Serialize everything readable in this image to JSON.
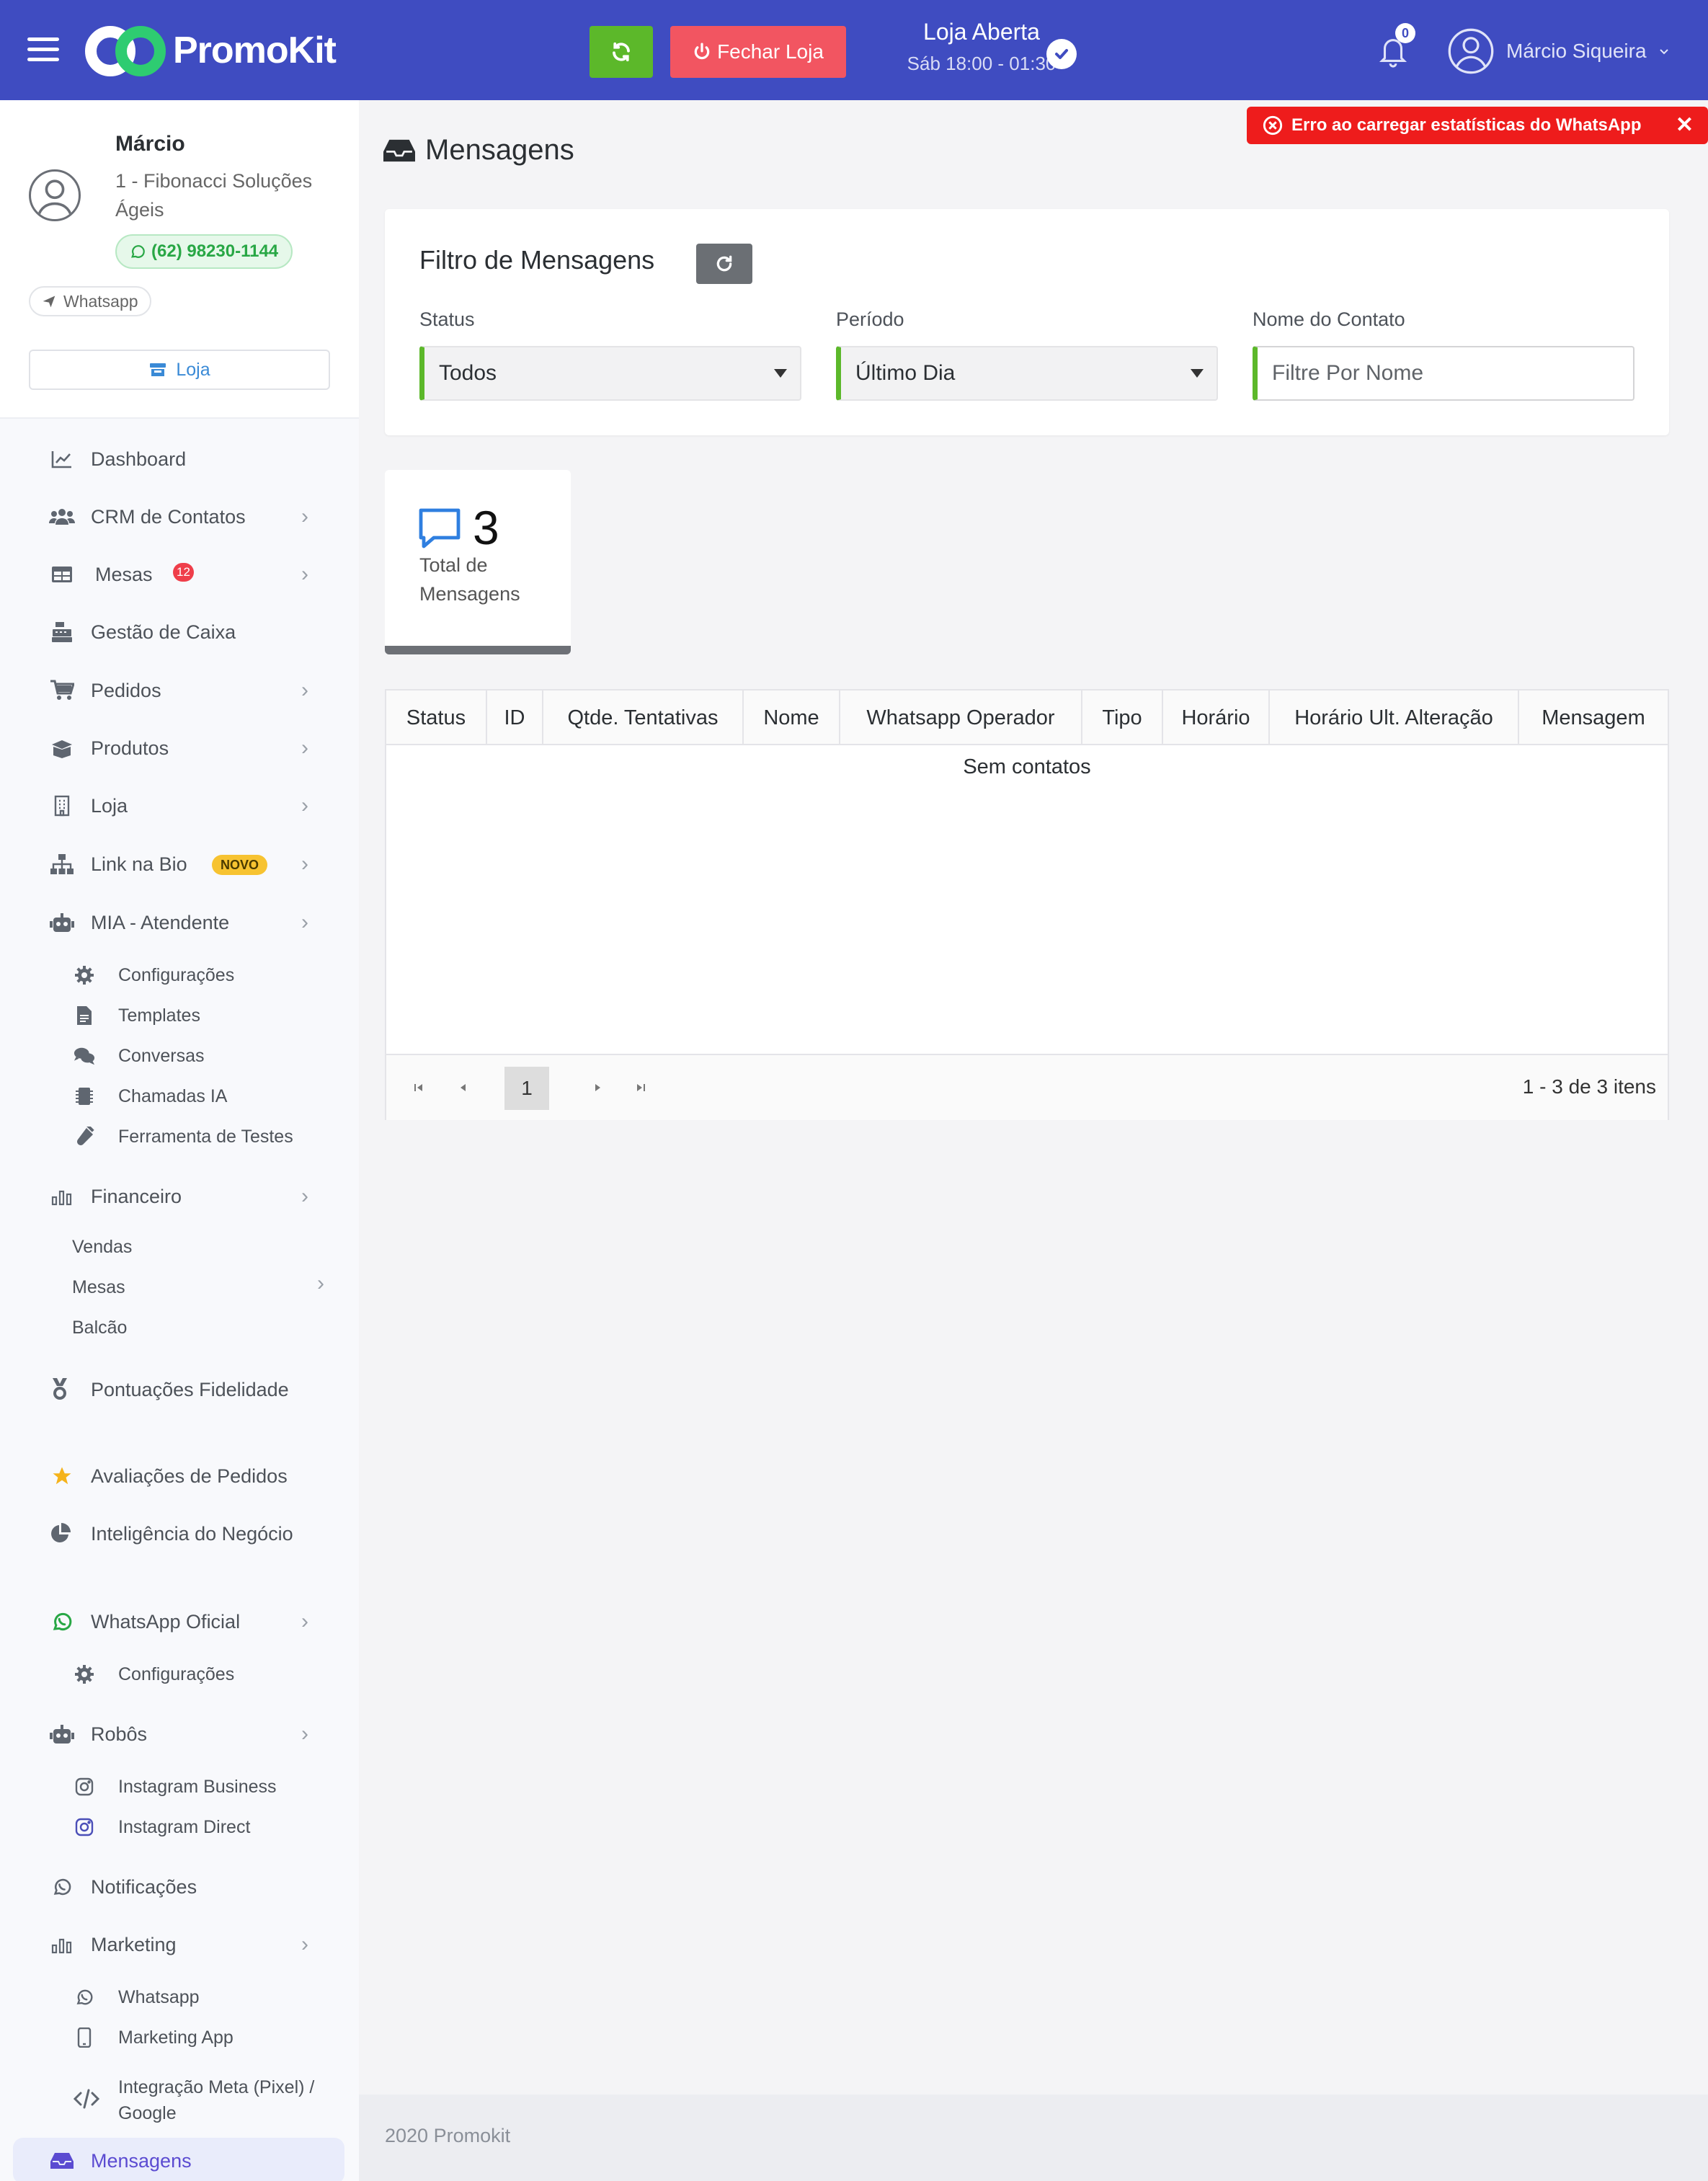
{
  "app": {
    "brand": "PromoKit",
    "brand_color": "#3f4cc1"
  },
  "header": {
    "close_store_label": "Fechar Loja",
    "store_status": "Loja Aberta",
    "store_hours": "Sáb 18:00 - 01:30",
    "notifications_count": "0",
    "user_name": "Márcio Siqueira"
  },
  "error_toast": {
    "message": "Erro ao carregar estatísticas do WhatsApp"
  },
  "profile": {
    "name": "Márcio",
    "company": "1 - Fibonacci Soluções Ágeis",
    "phone": "(62) 98230-1144",
    "channel": "Whatsapp",
    "store_button": "Loja"
  },
  "sidebar": {
    "items": [
      {
        "label": "Dashboard"
      },
      {
        "label": "CRM de Contatos"
      },
      {
        "label": "Mesas",
        "badge": "12"
      },
      {
        "label": "Gestão de Caixa"
      },
      {
        "label": "Pedidos"
      },
      {
        "label": "Produtos"
      },
      {
        "label": "Loja"
      },
      {
        "label": "Link na Bio",
        "badge": "NOVO"
      },
      {
        "label": "MIA - Atendente"
      }
    ],
    "mia_sub": [
      "Configurações",
      "Templates",
      "Conversas",
      "Chamadas IA",
      "Ferramenta de Testes"
    ],
    "financeiro": {
      "label": "Financeiro",
      "sub": [
        "Vendas",
        "Mesas",
        "Balcão"
      ]
    },
    "pontuacoes": "Pontuações Fidelidade",
    "avaliacoes": "Avaliações de Pedidos",
    "inteligencia": "Inteligência do Negócio",
    "whatsapp_oficial": {
      "label": "WhatsApp Oficial",
      "sub": [
        "Configurações"
      ]
    },
    "robos": {
      "label": "Robôs",
      "sub": [
        "Instagram Business",
        "Instagram Direct"
      ]
    },
    "notificacoes": "Notificações",
    "marketing": {
      "label": "Marketing",
      "sub": [
        "Whatsapp",
        "Marketing App",
        "Integração Meta (Pixel) / Google"
      ]
    },
    "mensagens": "Mensagens"
  },
  "main": {
    "page_title": "Mensagens",
    "filter": {
      "title": "Filtro de Mensagens",
      "status_label": "Status",
      "status_value": "Todos",
      "period_label": "Período",
      "period_value": "Último Dia",
      "contact_label": "Nome do Contato",
      "contact_placeholder": "Filtre Por Nome"
    },
    "stats": {
      "total": "3",
      "total_label": "Total de Mensagens"
    },
    "table": {
      "columns": [
        "Status",
        "ID",
        "Qtde. Tentativas",
        "Nome",
        "Whatsapp Operador",
        "Tipo",
        "Horário",
        "Horário Ult. Alteração",
        "Mensagem"
      ],
      "empty": "Sem contatos",
      "current_page": "1",
      "pager_info": "1 - 3 de 3 itens"
    }
  },
  "footer": {
    "text": "2020 Promokit"
  }
}
